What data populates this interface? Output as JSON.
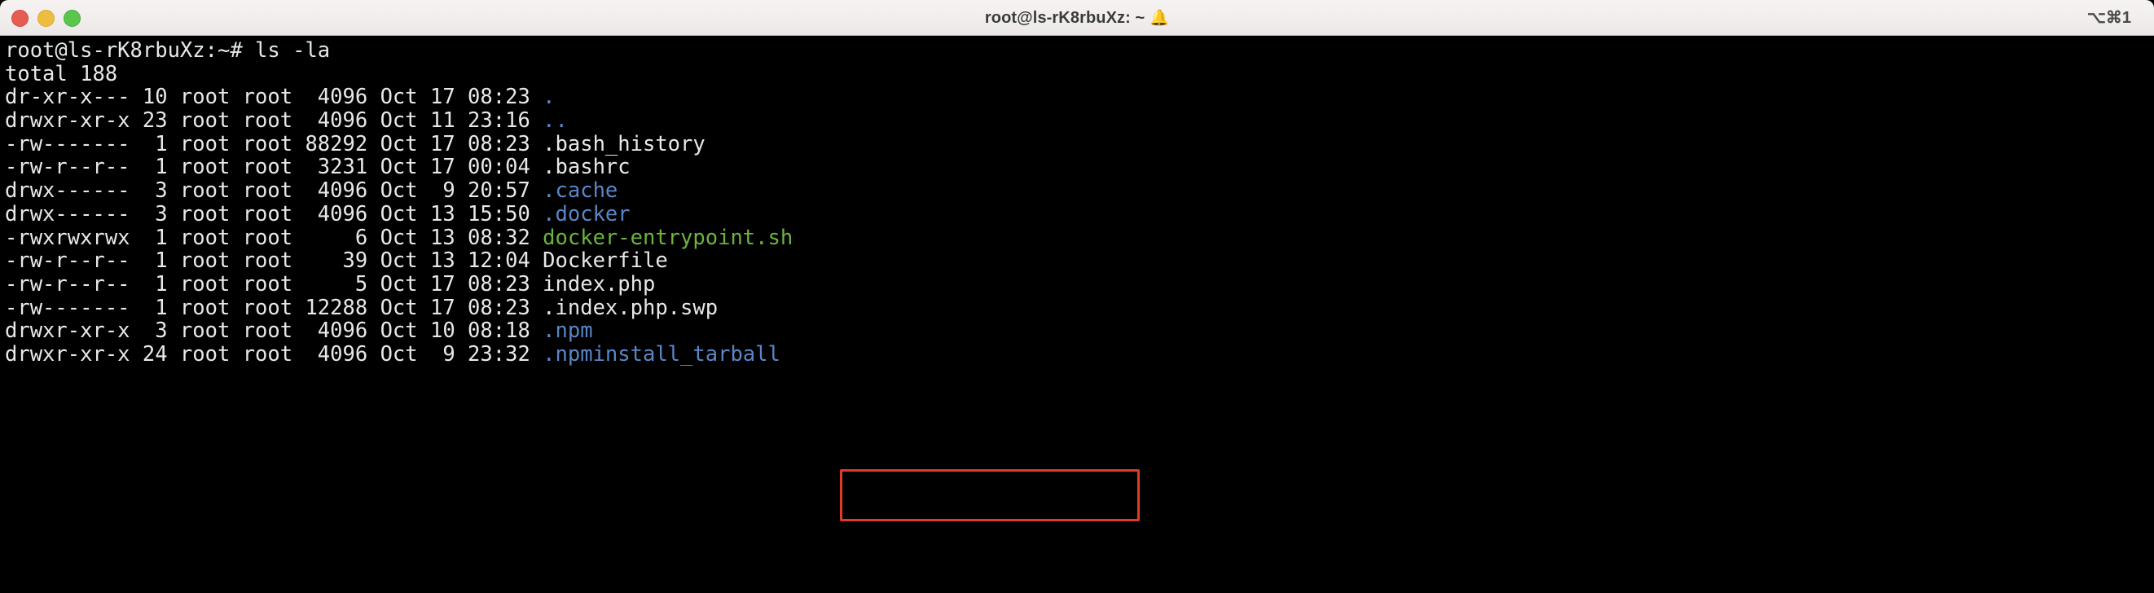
{
  "window": {
    "title": "root@ls-rK8rbuXz: ~",
    "title_icon": "bell-icon",
    "title_icon_glyph": "🔔",
    "shortcut": "⌥⌘1",
    "traffic_lights": [
      {
        "name": "close",
        "color": "#e45c52"
      },
      {
        "name": "minimize",
        "color": "#edbd3f"
      },
      {
        "name": "maximize",
        "color": "#5bc54c"
      }
    ]
  },
  "theme": {
    "background": "#000000",
    "foreground": "#e8e8e8",
    "dir_color": "#5a86c7",
    "exec_color": "#6cb33f",
    "annotation_color": "#e03b28",
    "titlebar_background": "#f2eeee",
    "titlebar_text": "#3b3b3b"
  },
  "terminal": {
    "prompt": "root@ls-rK8rbuXz:~#",
    "command": "ls -la",
    "total_line": "total 188",
    "rows": [
      {
        "perms": "dr-xr-x---",
        "links": "10",
        "owner": "root",
        "group": "root",
        "size": "4096",
        "month": "Oct",
        "day": "17",
        "time": "08:23",
        "name": ".",
        "color": "blue"
      },
      {
        "perms": "drwxr-xr-x",
        "links": "23",
        "owner": "root",
        "group": "root",
        "size": "4096",
        "month": "Oct",
        "day": "11",
        "time": "23:16",
        "name": "..",
        "color": "blue"
      },
      {
        "perms": "-rw-------",
        "links": "1",
        "owner": "root",
        "group": "root",
        "size": "88292",
        "month": "Oct",
        "day": "17",
        "time": "08:23",
        "name": ".bash_history",
        "color": "white"
      },
      {
        "perms": "-rw-r--r--",
        "links": "1",
        "owner": "root",
        "group": "root",
        "size": "3231",
        "month": "Oct",
        "day": "17",
        "time": "00:04",
        "name": ".bashrc",
        "color": "white"
      },
      {
        "perms": "drwx------",
        "links": "3",
        "owner": "root",
        "group": "root",
        "size": "4096",
        "month": "Oct",
        "day": "9",
        "time": "20:57",
        "name": ".cache",
        "color": "blue"
      },
      {
        "perms": "drwx------",
        "links": "3",
        "owner": "root",
        "group": "root",
        "size": "4096",
        "month": "Oct",
        "day": "13",
        "time": "15:50",
        "name": ".docker",
        "color": "blue"
      },
      {
        "perms": "-rwxrwxrwx",
        "links": "1",
        "owner": "root",
        "group": "root",
        "size": "6",
        "month": "Oct",
        "day": "13",
        "time": "08:32",
        "name": "docker-entrypoint.sh",
        "color": "green"
      },
      {
        "perms": "-rw-r--r--",
        "links": "1",
        "owner": "root",
        "group": "root",
        "size": "39",
        "month": "Oct",
        "day": "13",
        "time": "12:04",
        "name": "Dockerfile",
        "color": "white"
      },
      {
        "perms": "-rw-r--r--",
        "links": "1",
        "owner": "root",
        "group": "root",
        "size": "5",
        "month": "Oct",
        "day": "17",
        "time": "08:23",
        "name": "index.php",
        "color": "white"
      },
      {
        "perms": "-rw-------",
        "links": "1",
        "owner": "root",
        "group": "root",
        "size": "12288",
        "month": "Oct",
        "day": "17",
        "time": "08:23",
        "name": ".index.php.swp",
        "color": "white"
      },
      {
        "perms": "drwxr-xr-x",
        "links": "3",
        "owner": "root",
        "group": "root",
        "size": "4096",
        "month": "Oct",
        "day": "10",
        "time": "08:18",
        "name": ".npm",
        "color": "blue"
      },
      {
        "perms": "drwxr-xr-x",
        "links": "24",
        "owner": "root",
        "group": "root",
        "size": "4096",
        "month": "Oct",
        "day": "9",
        "time": "23:32",
        "name": ".npminstall_tarball",
        "color": "blue"
      }
    ],
    "annotation": {
      "label": "highlight-box",
      "targets": [
        "index.php",
        ".index.php.swp"
      ]
    }
  }
}
